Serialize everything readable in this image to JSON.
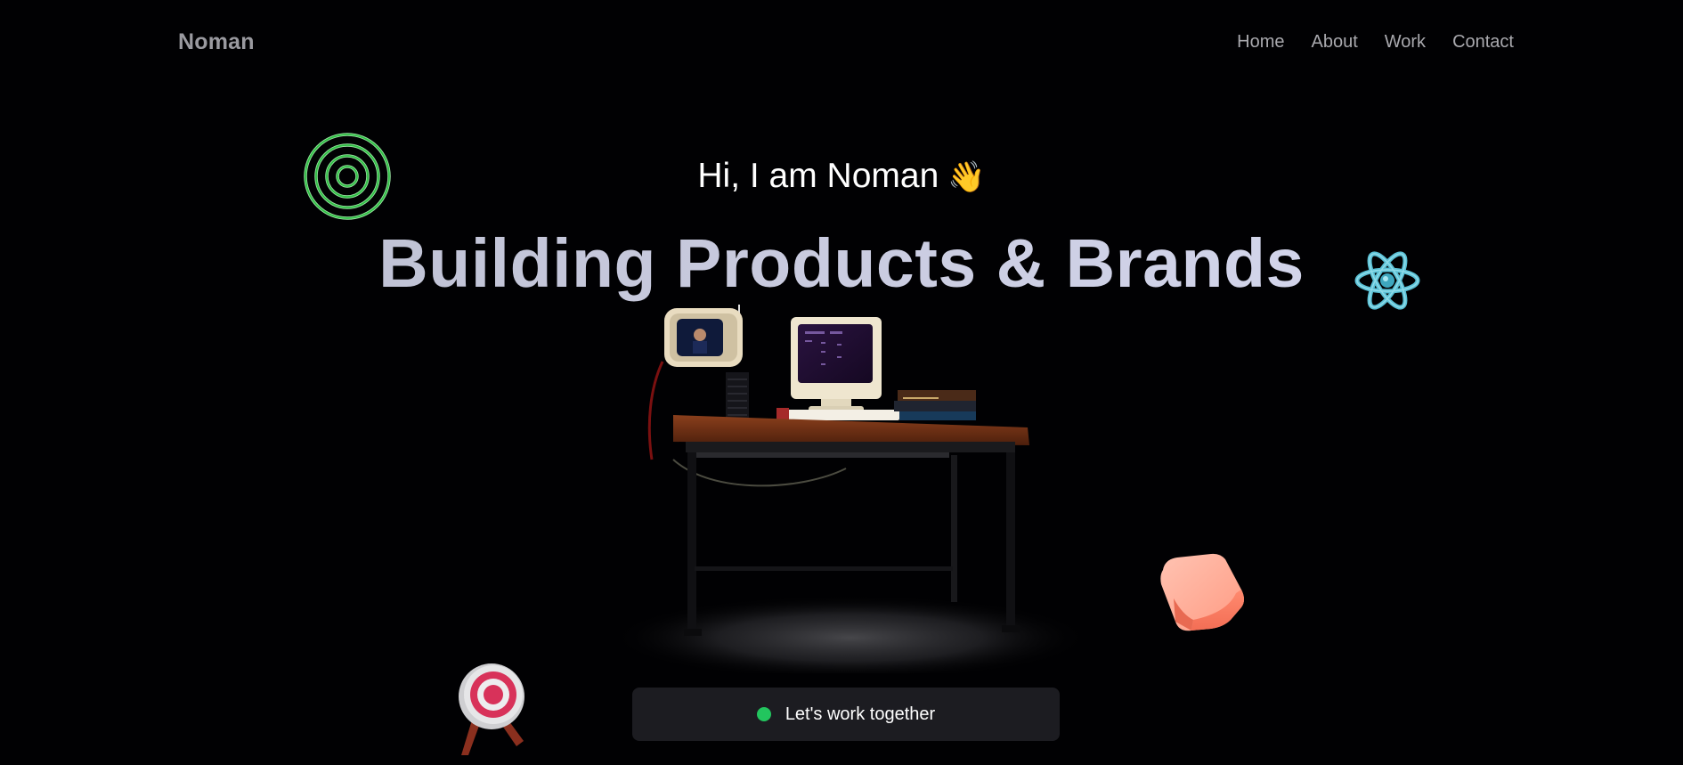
{
  "header": {
    "logo": "Noman",
    "nav": [
      {
        "label": "Home"
      },
      {
        "label": "About"
      },
      {
        "label": "Work"
      },
      {
        "label": "Contact"
      }
    ]
  },
  "hero": {
    "greeting": "Hi, I am Noman",
    "greeting_emoji": "👋",
    "headline": "Building Products & Brands",
    "cta_label": "Let's work together",
    "cta_status_color": "#22c55e"
  },
  "decorations": {
    "rings_icon": "concentric-rings-icon",
    "atom_icon": "react-atom-icon",
    "cube_icon": "coral-cube-icon",
    "target_icon": "archery-target-icon",
    "scene": "retro-computer-desk"
  },
  "colors": {
    "background": "#010103",
    "rings": "#3fcf4f",
    "atom": "#5bc1d6",
    "cube": "#ff8f78",
    "target": "#d8325a"
  }
}
